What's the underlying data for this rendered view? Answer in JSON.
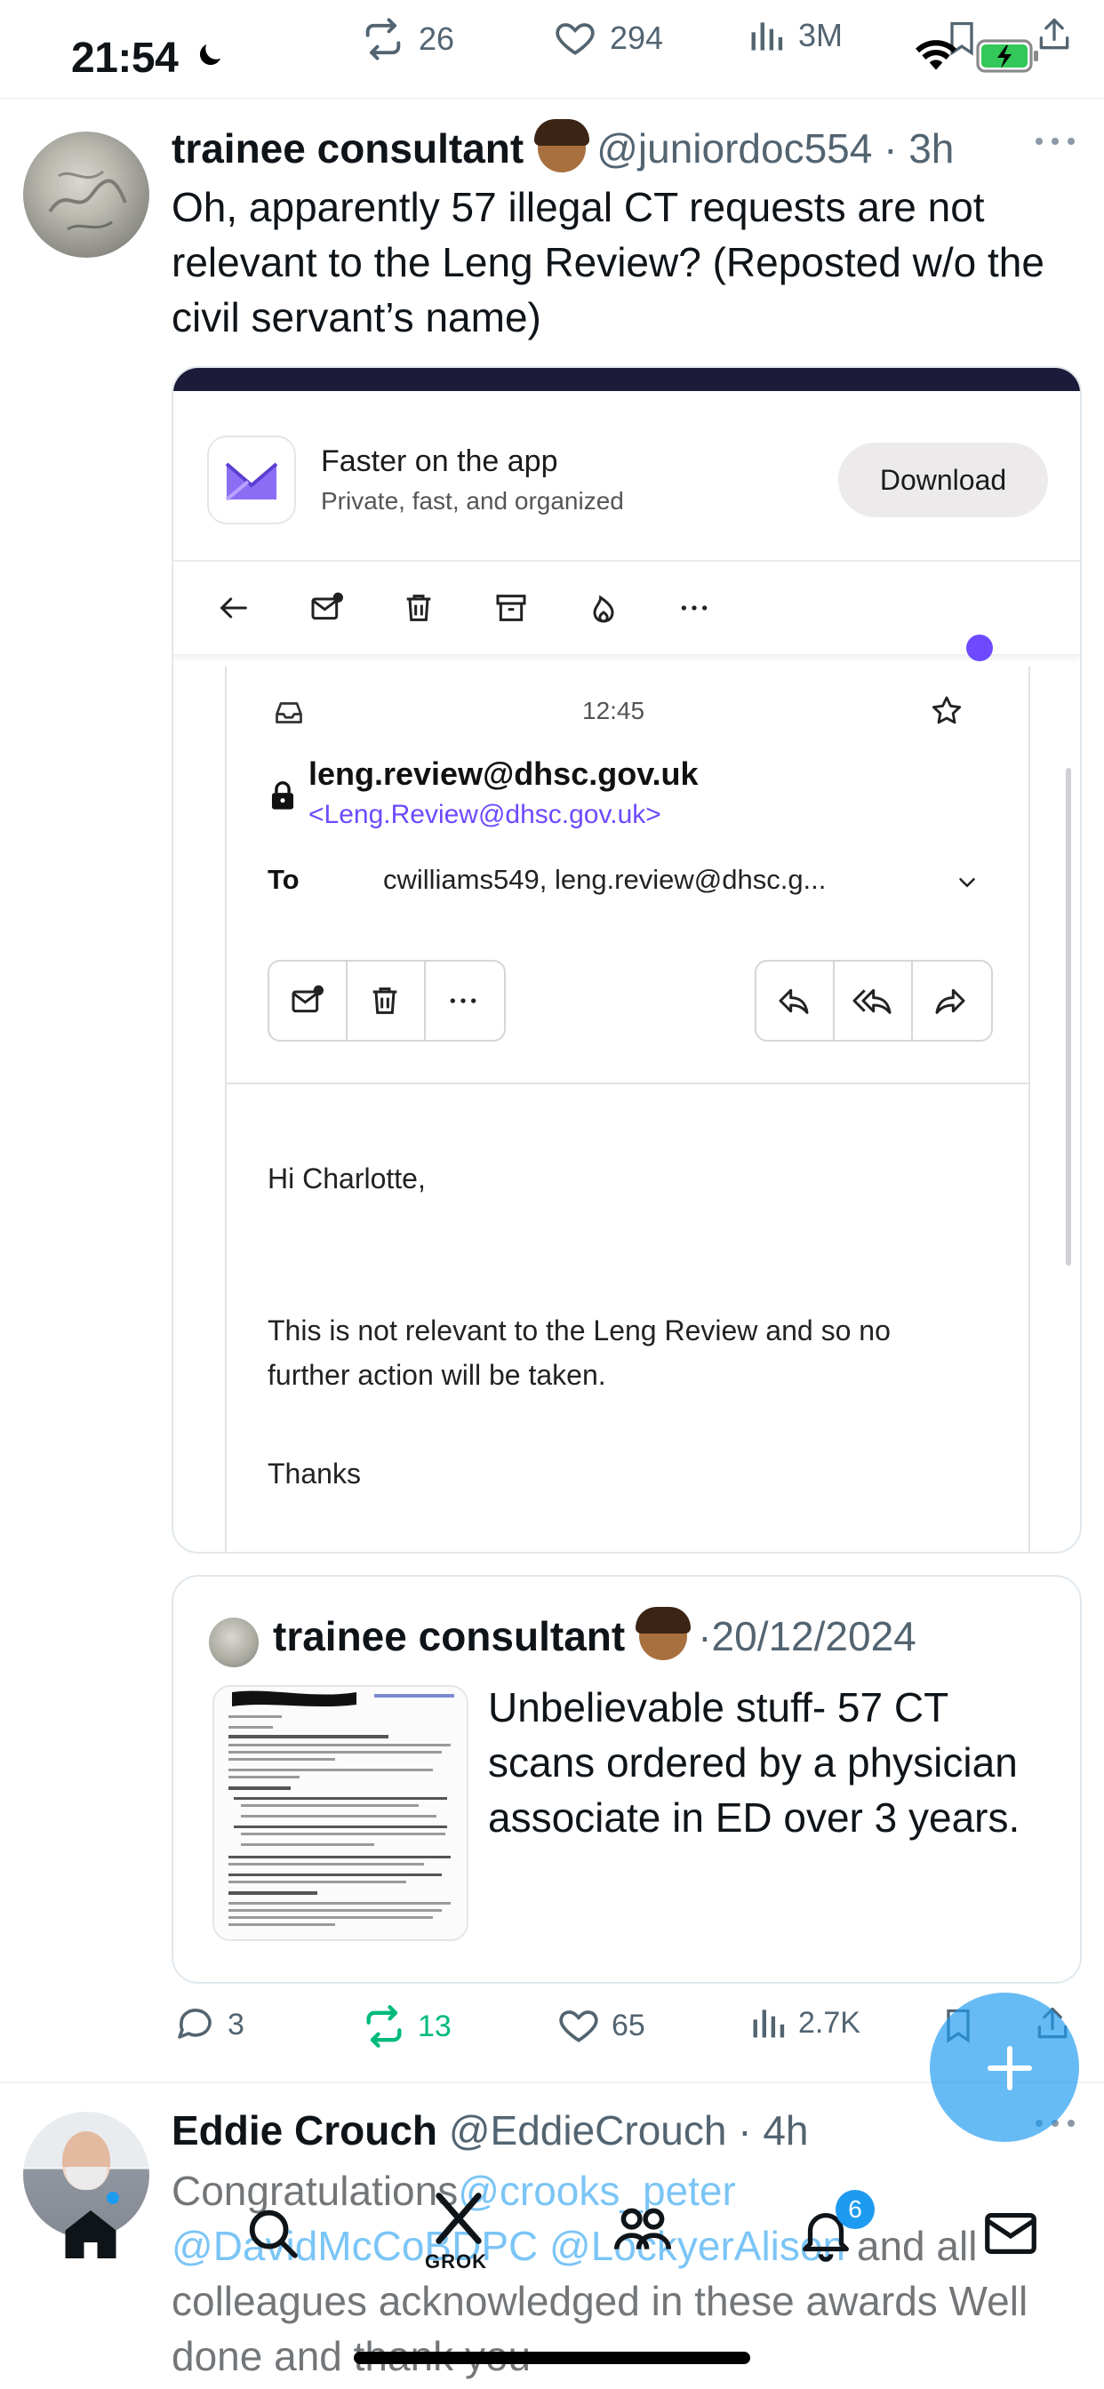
{
  "status_bar": {
    "time": "21:54"
  },
  "prev_tweet_stats": {
    "retweets": "26",
    "likes": "294",
    "views": "3M"
  },
  "tweet1": {
    "display_name": "trainee consultant",
    "handle": "@juniordoc554",
    "time": "3h",
    "text": "Oh, apparently 57 illegal CT requests are not relevant to the Leng Review? (Reposted w/o the civil servant’s name)",
    "media": {
      "banner_title": "Faster on the app",
      "banner_subtitle": "Private, fast, and organized",
      "download_label": "Download",
      "mail_time": "12:45",
      "sender_name": "leng.review@dhsc.gov.uk",
      "sender_email": "<Leng.Review@dhsc.gov.uk>",
      "to_label": "To",
      "to_values": "cwilliams549,   leng.review@dhsc.g...",
      "greeting": "Hi Charlotte,",
      "body": "This is not relevant to the Leng Review and so no further action will be taken.",
      "signoff": "Thanks"
    },
    "quote": {
      "display_name": "trainee consultant",
      "date": "20/12/2024",
      "text": "Unbelievable stuff- 57 CT scans ordered by a physician associate in ED over 3 years."
    },
    "actions": {
      "replies": "3",
      "retweets": "13",
      "likes": "65",
      "views": "2.7K"
    }
  },
  "tweet2": {
    "display_name": "Eddie Crouch",
    "handle": "@EddieCrouch",
    "time": "4h",
    "text_lead": "Congratulations",
    "mention1": "@crooks_peter",
    "mention2": "@DavidMcCoBDPC",
    "mention3": "@LockyerAlison",
    "text_tail": "and all colleagues acknowledged in these awards Well done and thank you"
  },
  "bottom_nav": {
    "grok_label": "GROK",
    "notifications_count": "6"
  },
  "colors": {
    "accent": "#1d9bf0",
    "retweet_green": "#00ba7c",
    "proton_purple": "#6d4aff"
  }
}
